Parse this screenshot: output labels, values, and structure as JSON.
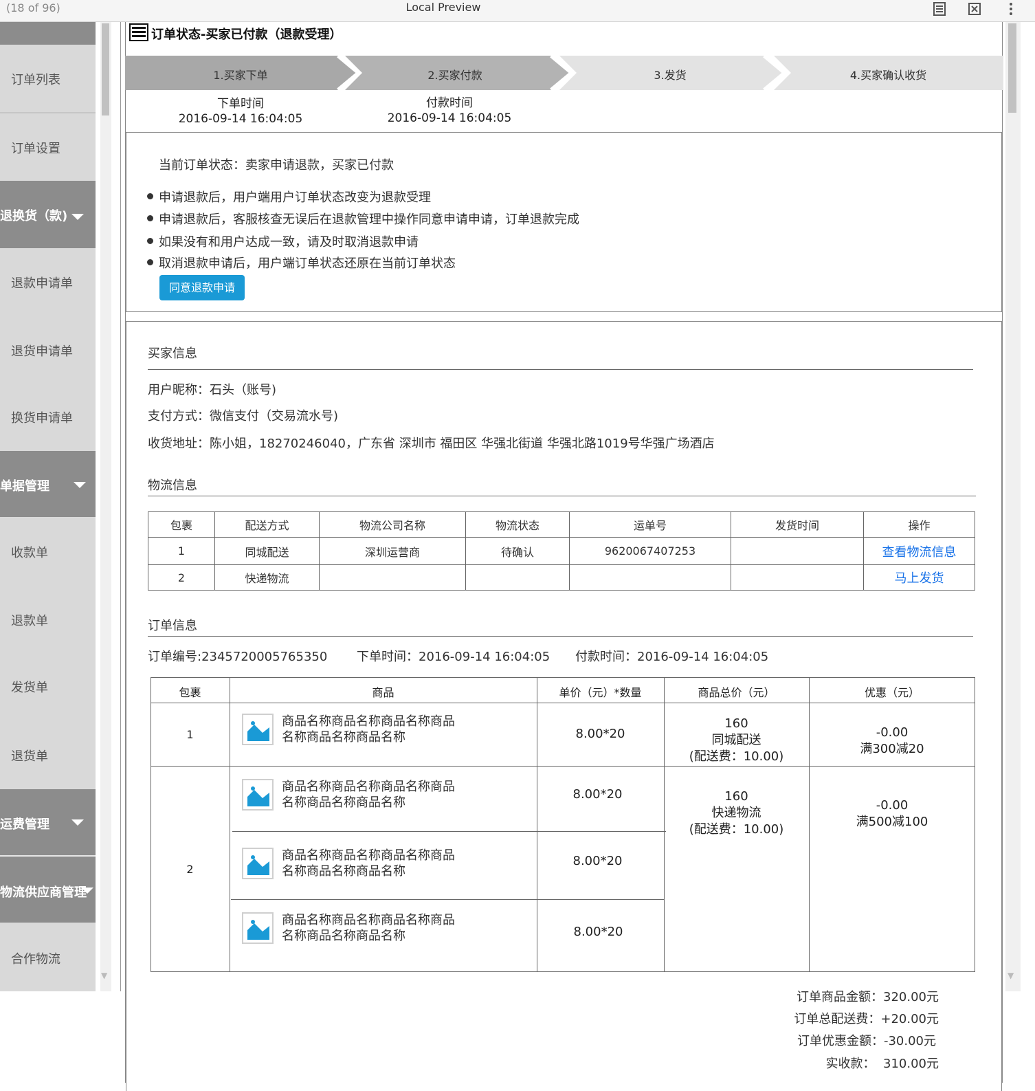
{
  "window": {
    "page_count": "(18 of 96)",
    "title": "Local Preview"
  },
  "sidebar": {
    "items": [
      {
        "label": "订单列表"
      },
      {
        "label": "订单设置"
      },
      {
        "label": "退换货（款)",
        "group": true
      },
      {
        "label": "退款申请单"
      },
      {
        "label": "退货申请单"
      },
      {
        "label": "换货申请单"
      },
      {
        "label": "单据管理",
        "group": true
      },
      {
        "label": "收款单"
      },
      {
        "label": "退款单"
      },
      {
        "label": "发货单"
      },
      {
        "label": "退货单"
      },
      {
        "label": "运费管理",
        "group": true
      },
      {
        "label": "物流供应商管理",
        "group": true
      },
      {
        "label": "合作物流"
      }
    ]
  },
  "header": {
    "title": "订单状态-买家已付款（退款受理）"
  },
  "steps": [
    {
      "label": "1.买家下单",
      "time_label": "下单时间",
      "time": "2016-09-14 16:04:05"
    },
    {
      "label": "2.买家付款",
      "time_label": "付款时间",
      "time": "2016-09-14 16:04:05"
    },
    {
      "label": "3.发货"
    },
    {
      "label": "4.买家确认收货"
    }
  ],
  "status": {
    "current": "当前订单状态：卖家申请退款，买家已付款",
    "bullets": [
      "申请退款后，用户端用户订单状态改变为退款受理",
      "申请退款后，客服核查无误后在退款管理中操作同意申请申请，订单退款完成",
      "如果没有和用户达成一致，请及时取消退款申请",
      "取消退款申请后，用户端订单状态还原在当前订单状态"
    ],
    "agree_button": "同意退款申请"
  },
  "buyer": {
    "section_title": "买家信息",
    "nickname": "用户昵称：石头（账号)",
    "payment": "支付方式：微信支付（交易流水号)",
    "address": "收货地址：陈小姐，18270246040，广东省 深圳市 福田区 华强北街道 华强北路1019号华强广场酒店"
  },
  "logistics": {
    "section_title": "物流信息",
    "headers": [
      "包裹",
      "配送方式",
      "物流公司名称",
      "物流状态",
      "运单号",
      "发货时间",
      "操作"
    ],
    "rows": [
      {
        "pkg": "1",
        "method": "同城配送",
        "company": "深圳运营商",
        "status": "待确认",
        "tracking": "9620067407253",
        "ship_time": "",
        "action": "查看物流信息"
      },
      {
        "pkg": "2",
        "method": "快递物流",
        "company": "",
        "status": "",
        "tracking": "",
        "ship_time": "",
        "action": "马上发货"
      }
    ]
  },
  "order": {
    "section_title": "订单信息",
    "order_no": "订单编号:2345720005765350",
    "order_time": "下单时间：2016-09-14 16:04:05",
    "pay_time": "付款时间：2016-09-14 16:04:05",
    "headers": [
      "包裹",
      "商品",
      "单价（元）*数量",
      "商品总价（元）",
      "优惠（元）"
    ],
    "product_name_1": "商品名称商品名称商品名称商品",
    "product_name_2": "名称商品名称商品名称",
    "qty": "8.00*20",
    "pkg1": {
      "no": "1",
      "total": "160",
      "method": "同城配送",
      "fee": "(配送费：10.00)",
      "discount": "-0.00",
      "promo": "满300减20"
    },
    "pkg2": {
      "no": "2",
      "total": "160",
      "method": "快递物流",
      "fee": "(配送费：10.00)",
      "discount": "-0.00",
      "promo": "满500减100"
    }
  },
  "summary": {
    "goods_amount": "订单商品金额：320.00元",
    "shipping": "订单总配送费：+20.00元",
    "discount": "订单优惠金额：-30.00元",
    "received": "实收款：  310.00元"
  },
  "colors": {
    "accent": "#1a9ad6",
    "link": "#1a73e8",
    "sidebar_bg": "#d9d9d9",
    "sidebar_group": "#8c8c8c"
  }
}
